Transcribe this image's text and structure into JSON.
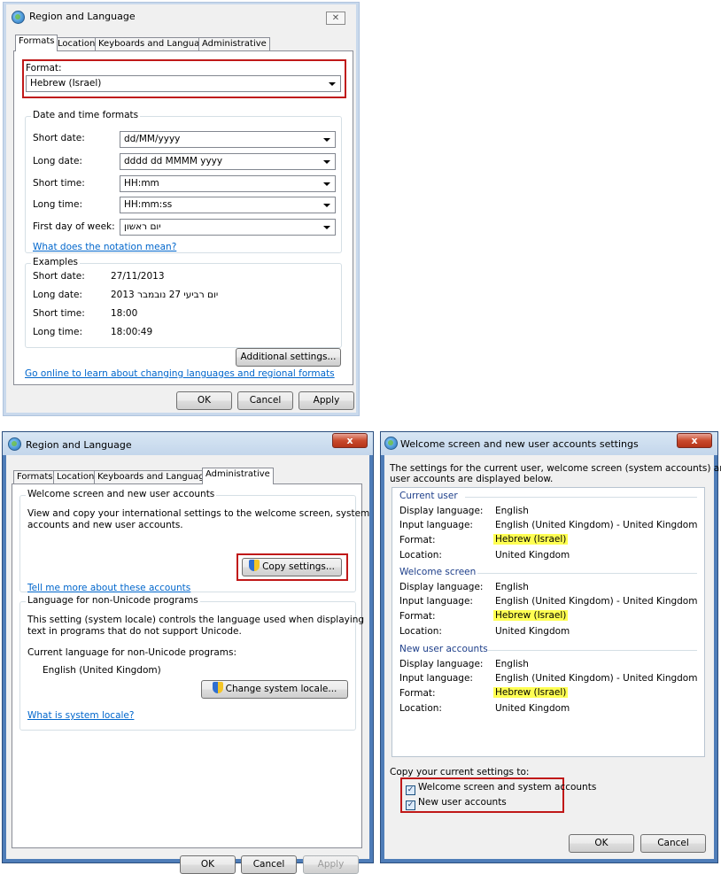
{
  "win1": {
    "title": "Region and Language",
    "close": "✕",
    "tabs": [
      "Formats",
      "Location",
      "Keyboards and Languages",
      "Administrative"
    ],
    "format_label": "Format:",
    "format_value": "Hebrew (Israel)",
    "dt_group": "Date and time formats",
    "short_date_label": "Short date:",
    "short_date_value": "dd/MM/yyyy",
    "long_date_label": "Long date:",
    "long_date_value": "dddd dd MMMM yyyy",
    "short_time_label": "Short time:",
    "short_time_value": "HH:mm",
    "long_time_label": "Long time:",
    "long_time_value": "HH:mm:ss",
    "first_day_label": "First day of week:",
    "first_day_value": "יום ראשון",
    "notation_link": "What does the notation mean?",
    "examples_group": "Examples",
    "ex_short_date_label": "Short date:",
    "ex_short_date_value": "27/11/2013",
    "ex_long_date_label": "Long date:",
    "ex_long_date_value": "יום רביעי 27 נובמבר 2013",
    "ex_short_time_label": "Short time:",
    "ex_short_time_value": "18:00",
    "ex_long_time_label": "Long time:",
    "ex_long_time_value": "18:00:49",
    "additional_settings": "Additional settings...",
    "online_link": "Go online to learn about changing languages and regional formats",
    "ok": "OK",
    "cancel": "Cancel",
    "apply": "Apply"
  },
  "win2": {
    "title": "Region and Language",
    "close": "x",
    "tabs": [
      "Formats",
      "Location",
      "Keyboards and Languages",
      "Administrative"
    ],
    "welcome_group": "Welcome screen and new user accounts",
    "welcome_desc_1": "View and copy your international settings to the welcome screen, system",
    "welcome_desc_2": "accounts and new user accounts.",
    "copy_settings": "Copy settings...",
    "tell_me_link": "Tell me more about these accounts",
    "nonunicode_group": "Language for non-Unicode programs",
    "nonunicode_desc_1": "This setting (system locale) controls the language used when displaying",
    "nonunicode_desc_2": "text in programs that do not support Unicode.",
    "current_lang_label": "Current language for non-Unicode programs:",
    "current_lang_value": "English (United Kingdom)",
    "change_locale": "Change system locale...",
    "system_locale_link": "What is system locale?",
    "ok": "OK",
    "cancel": "Cancel",
    "apply": "Apply"
  },
  "win3": {
    "title": "Welcome screen and new user accounts settings",
    "close": "x",
    "intro_1": "The settings for the current user, welcome screen (system accounts) and new",
    "intro_2": "user accounts are displayed below.",
    "sections": [
      {
        "heading": "Current user",
        "display_label": "Display language:",
        "display": "English",
        "input_label": "Input language:",
        "input": "English (United Kingdom) - United Kingdom",
        "format_label": "Format:",
        "format": "Hebrew (Israel)",
        "location_label": "Location:",
        "location": "United Kingdom"
      },
      {
        "heading": "Welcome screen",
        "display_label": "Display language:",
        "display": "English",
        "input_label": "Input language:",
        "input": "English (United Kingdom) - United Kingdom",
        "format_label": "Format:",
        "format": "Hebrew (Israel)",
        "location_label": "Location:",
        "location": "United Kingdom"
      },
      {
        "heading": "New user accounts",
        "display_label": "Display language:",
        "display": "English",
        "input_label": "Input language:",
        "input": "English (United Kingdom) - United Kingdom",
        "format_label": "Format:",
        "format": "Hebrew (Israel)",
        "location_label": "Location:",
        "location": "United Kingdom"
      }
    ],
    "copy_to_label": "Copy your current settings to:",
    "check_welcome": "Welcome screen and system accounts",
    "check_new_users": "New user accounts",
    "check_mark": "✓",
    "ok": "OK",
    "cancel": "Cancel"
  },
  "colors": {
    "highlight": "#ffff52",
    "annotation_red": "#c01818",
    "link": "#0066cc"
  }
}
